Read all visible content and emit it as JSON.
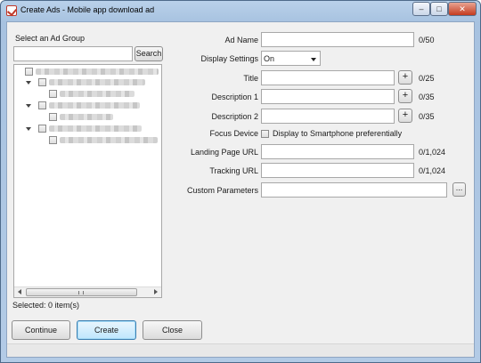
{
  "window": {
    "title": "Create Ads - Mobile app download ad",
    "min_glyph": "–",
    "max_glyph": "□",
    "close_glyph": "✕"
  },
  "left": {
    "heading": "Select an Ad Group",
    "search_value": "",
    "search_button": "Search",
    "selected_status": "Selected: 0 item(s)"
  },
  "form": {
    "ad_name": {
      "label": "Ad Name",
      "value": "",
      "counter": "0/50"
    },
    "display_settings": {
      "label": "Display Settings",
      "value": "On"
    },
    "title": {
      "label": "Title",
      "value": "",
      "counter": "0/25",
      "plus": "+"
    },
    "description1": {
      "label": "Description 1",
      "value": "",
      "counter": "0/35",
      "plus": "+"
    },
    "description2": {
      "label": "Description 2",
      "value": "",
      "counter": "0/35",
      "plus": "+"
    },
    "focus_device": {
      "label": "Focus Device",
      "checkbox_label": "Display to Smartphone preferentially",
      "checked": false
    },
    "landing_page_url": {
      "label": "Landing Page URL",
      "value": "",
      "counter": "0/1,024"
    },
    "tracking_url": {
      "label": "Tracking URL",
      "value": "",
      "counter": "0/1,024"
    },
    "custom_parameters": {
      "label": "Custom Parameters",
      "value": "",
      "more": "..."
    }
  },
  "buttons": {
    "continue": "Continue",
    "create": "Create",
    "close": "Close"
  }
}
